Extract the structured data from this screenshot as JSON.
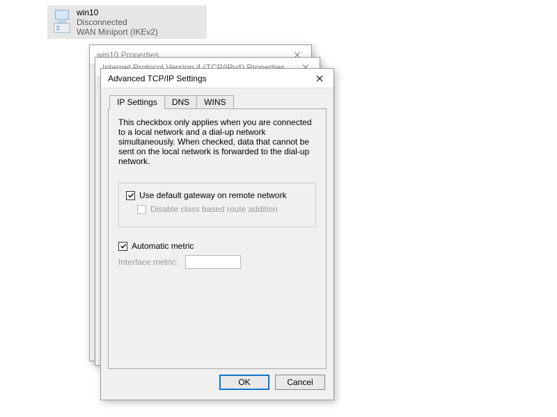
{
  "connection": {
    "name": "win10",
    "status": "Disconnected",
    "device": "WAN Miniport (IKEv2)"
  },
  "dialogs": {
    "back1_title": "win10 Properties",
    "back2_title": "Internet Protocol Version 4 (TCP/IPv4) Properties",
    "front_title": "Advanced TCP/IP Settings"
  },
  "tabs": {
    "ip": "IP Settings",
    "dns": "DNS",
    "wins": "WINS"
  },
  "page": {
    "description": "This checkbox only applies when you are connected to a local network and a dial-up network simultaneously.  When checked, data that cannot be sent on the local network is forwarded to the dial-up network.",
    "chk_default_gw": "Use default gateway on remote network",
    "chk_default_gw_checked": true,
    "chk_classroute": "Disable class based route addition",
    "chk_classroute_enabled": false,
    "chk_autometric": "Automatic metric",
    "chk_autometric_checked": true,
    "lbl_interface_metric": "Interface metric:",
    "interface_metric_value": ""
  },
  "buttons": {
    "ok": "OK",
    "cancel": "Cancel"
  }
}
